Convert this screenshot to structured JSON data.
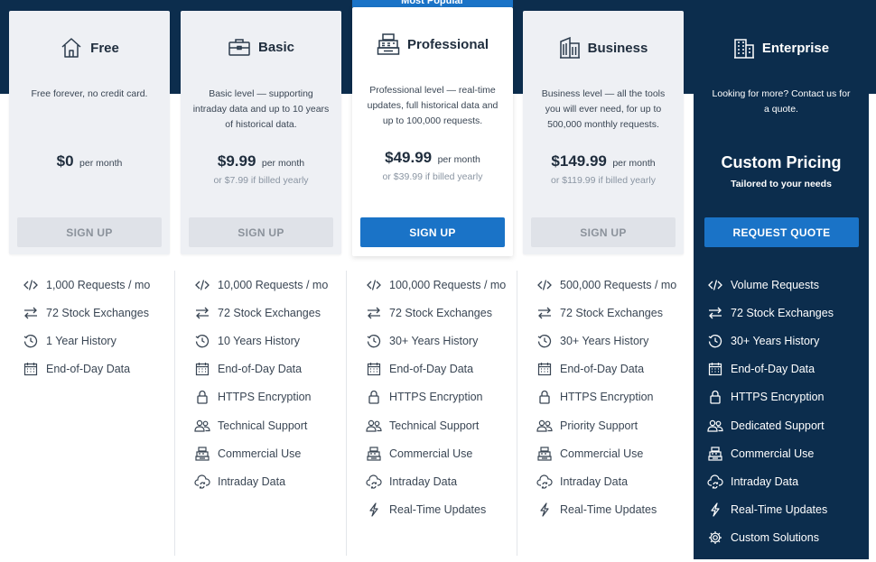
{
  "popular_label": "Most Popular",
  "plans": [
    {
      "name": "Free",
      "icon": "house-icon",
      "description": "Free forever, no credit card.",
      "price": "$0",
      "per": "per month",
      "yearly": "",
      "button": "SIGN UP",
      "features": [
        {
          "icon": "code-icon",
          "label": "1,000 Requests / mo"
        },
        {
          "icon": "exchange-arrows-icon",
          "label": "72 Stock Exchanges"
        },
        {
          "icon": "history-clock-icon",
          "label": "1 Year History"
        },
        {
          "icon": "calendar-icon",
          "label": "End-of-Day Data"
        }
      ]
    },
    {
      "name": "Basic",
      "icon": "briefcase-icon",
      "description": "Basic level — supporting intraday data and up to 10 years of historical data.",
      "price": "$9.99",
      "per": "per month",
      "yearly": "or $7.99 if billed yearly",
      "button": "SIGN UP",
      "features": [
        {
          "icon": "code-icon",
          "label": "10,000 Requests / mo"
        },
        {
          "icon": "exchange-arrows-icon",
          "label": "72 Stock Exchanges"
        },
        {
          "icon": "history-clock-icon",
          "label": "10 Years History"
        },
        {
          "icon": "calendar-icon",
          "label": "End-of-Day Data"
        },
        {
          "icon": "lock-icon",
          "label": "HTTPS Encryption"
        },
        {
          "icon": "users-icon",
          "label": "Technical Support"
        },
        {
          "icon": "cash-register-icon",
          "label": "Commercial Use"
        },
        {
          "icon": "cloud-sync-icon",
          "label": "Intraday Data"
        }
      ]
    },
    {
      "name": "Professional",
      "icon": "cash-register-icon",
      "description": "Professional level — real-time updates, full historical data and up to 100,000 requests.",
      "price": "$49.99",
      "per": "per month",
      "yearly": "or $39.99 if billed yearly",
      "button": "SIGN UP",
      "features": [
        {
          "icon": "code-icon",
          "label": "100,000 Requests / mo"
        },
        {
          "icon": "exchange-arrows-icon",
          "label": "72 Stock Exchanges"
        },
        {
          "icon": "history-clock-icon",
          "label": "30+ Years History"
        },
        {
          "icon": "calendar-icon",
          "label": "End-of-Day Data"
        },
        {
          "icon": "lock-icon",
          "label": "HTTPS Encryption"
        },
        {
          "icon": "users-icon",
          "label": "Technical Support"
        },
        {
          "icon": "cash-register-icon",
          "label": "Commercial Use"
        },
        {
          "icon": "cloud-sync-icon",
          "label": "Intraday Data"
        },
        {
          "icon": "lightning-icon",
          "label": "Real-Time Updates"
        }
      ]
    },
    {
      "name": "Business",
      "icon": "building-icon",
      "description": "Business level — all the tools you will ever need, for up to 500,000 monthly requests.",
      "price": "$149.99",
      "per": "per month",
      "yearly": "or $119.99 if billed yearly",
      "button": "SIGN UP",
      "features": [
        {
          "icon": "code-icon",
          "label": "500,000 Requests / mo"
        },
        {
          "icon": "exchange-arrows-icon",
          "label": "72 Stock Exchanges"
        },
        {
          "icon": "history-clock-icon",
          "label": "30+ Years History"
        },
        {
          "icon": "calendar-icon",
          "label": "End-of-Day Data"
        },
        {
          "icon": "lock-icon",
          "label": "HTTPS Encryption"
        },
        {
          "icon": "users-icon",
          "label": "Priority Support"
        },
        {
          "icon": "cash-register-icon",
          "label": "Commercial Use"
        },
        {
          "icon": "cloud-sync-icon",
          "label": "Intraday Data"
        },
        {
          "icon": "lightning-icon",
          "label": "Real-Time Updates"
        }
      ]
    },
    {
      "name": "Enterprise",
      "icon": "office-building-icon",
      "description": "Looking for more? Contact us for a quote.",
      "custom_title": "Custom Pricing",
      "custom_sub": "Tailored to your needs",
      "button": "REQUEST QUOTE",
      "features": [
        {
          "icon": "code-icon",
          "label": "Volume Requests"
        },
        {
          "icon": "exchange-arrows-icon",
          "label": "72 Stock Exchanges"
        },
        {
          "icon": "history-clock-icon",
          "label": "30+ Years History"
        },
        {
          "icon": "calendar-icon",
          "label": "End-of-Day Data"
        },
        {
          "icon": "lock-icon",
          "label": "HTTPS Encryption"
        },
        {
          "icon": "users-icon",
          "label": "Dedicated Support"
        },
        {
          "icon": "cash-register-icon",
          "label": "Commercial Use"
        },
        {
          "icon": "cloud-sync-icon",
          "label": "Intraday Data"
        },
        {
          "icon": "lightning-icon",
          "label": "Real-Time Updates"
        },
        {
          "icon": "gear-icon",
          "label": "Custom Solutions"
        }
      ]
    }
  ],
  "colors": {
    "navy": "#0c2d4d",
    "accent": "#1a73c7",
    "card_bg": "#eef0f4",
    "muted_button": "#dfe2e8"
  }
}
